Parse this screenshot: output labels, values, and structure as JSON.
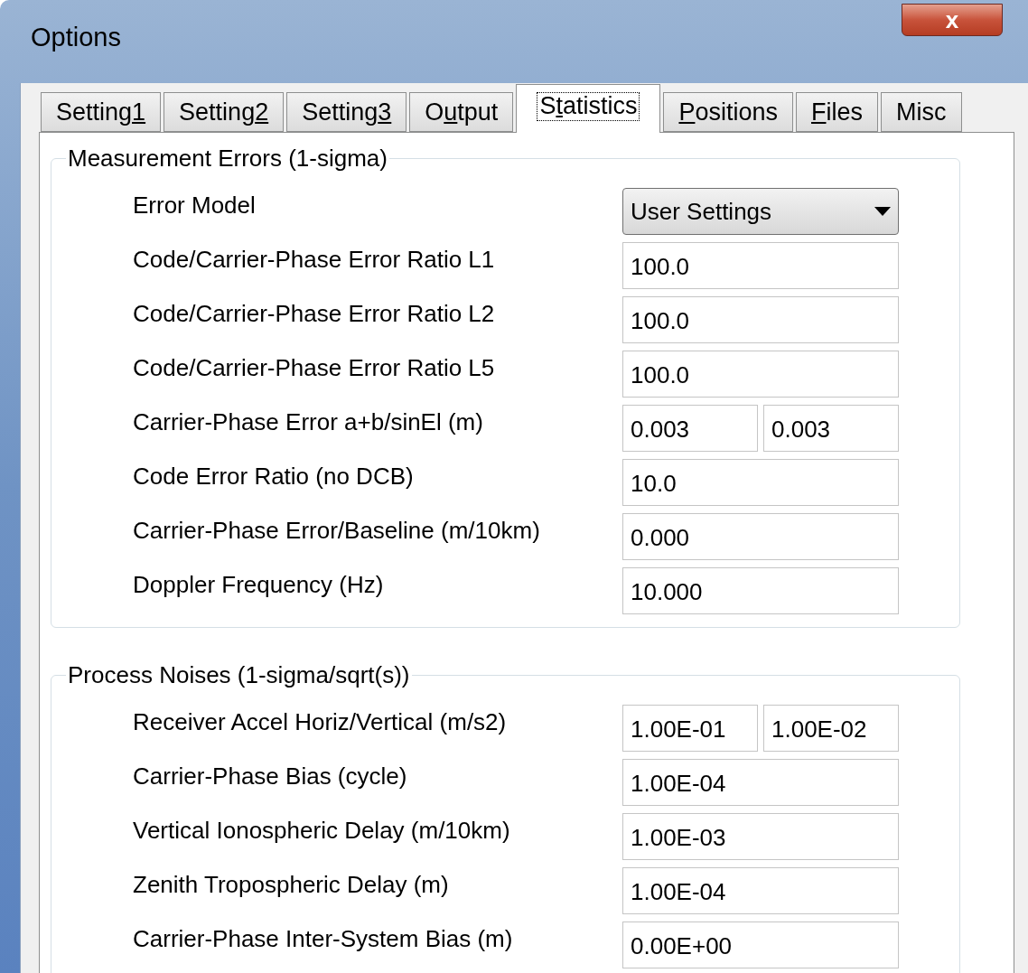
{
  "window": {
    "title": "Options",
    "close_label": "x"
  },
  "tabs": [
    {
      "before": "Setting",
      "key": "1",
      "selected": false
    },
    {
      "before": "Setting",
      "key": "2",
      "selected": false
    },
    {
      "before": "Setting",
      "key": "3",
      "selected": false
    },
    {
      "before": "O",
      "key": "u",
      "after": "tput",
      "selected": false
    },
    {
      "before": "S",
      "key": "t",
      "after": "atistics",
      "selected": true
    },
    {
      "key": "P",
      "after": "ositions",
      "selected": false
    },
    {
      "key": "F",
      "after": "iles",
      "selected": false
    },
    {
      "before": "Misc",
      "selected": false
    }
  ],
  "groups": [
    {
      "title": "Measurement Errors (1-sigma)",
      "rows": [
        {
          "kind": "dropdown",
          "label": "Error Model",
          "value": "User Settings"
        },
        {
          "kind": "field",
          "label": "Code/Carrier-Phase Error Ratio L1",
          "values": [
            "100.0"
          ]
        },
        {
          "kind": "field",
          "label": "Code/Carrier-Phase Error Ratio L2",
          "values": [
            "100.0"
          ]
        },
        {
          "kind": "field",
          "label": "Code/Carrier-Phase Error Ratio L5",
          "values": [
            "100.0"
          ]
        },
        {
          "kind": "pair",
          "label": "Carrier-Phase Error a+b/sinEl (m)",
          "values": [
            "0.003",
            "0.003"
          ]
        },
        {
          "kind": "field",
          "label": "Code Error Ratio (no DCB)",
          "values": [
            "10.0"
          ]
        },
        {
          "kind": "field",
          "label": "Carrier-Phase Error/Baseline (m/10km)",
          "values": [
            "0.000"
          ]
        },
        {
          "kind": "field",
          "label": "Doppler Frequency (Hz)",
          "values": [
            "10.000"
          ]
        }
      ]
    },
    {
      "title": "Process Noises (1-sigma/sqrt(s))",
      "rows": [
        {
          "kind": "pair",
          "label": "Receiver Accel Horiz/Vertical (m/s2)",
          "values": [
            "1.00E-01",
            "1.00E-02"
          ]
        },
        {
          "kind": "field",
          "label": "Carrier-Phase Bias (cycle)",
          "values": [
            "1.00E-04"
          ]
        },
        {
          "kind": "field",
          "label": "Vertical Ionospheric Delay (m/10km)",
          "values": [
            "1.00E-03"
          ]
        },
        {
          "kind": "field",
          "label": "Zenith Tropospheric Delay (m)",
          "values": [
            "1.00E-04"
          ]
        },
        {
          "kind": "field",
          "label": "Carrier-Phase Inter-System Bias (m)",
          "values": [
            "0.00E+00"
          ]
        }
      ]
    }
  ]
}
